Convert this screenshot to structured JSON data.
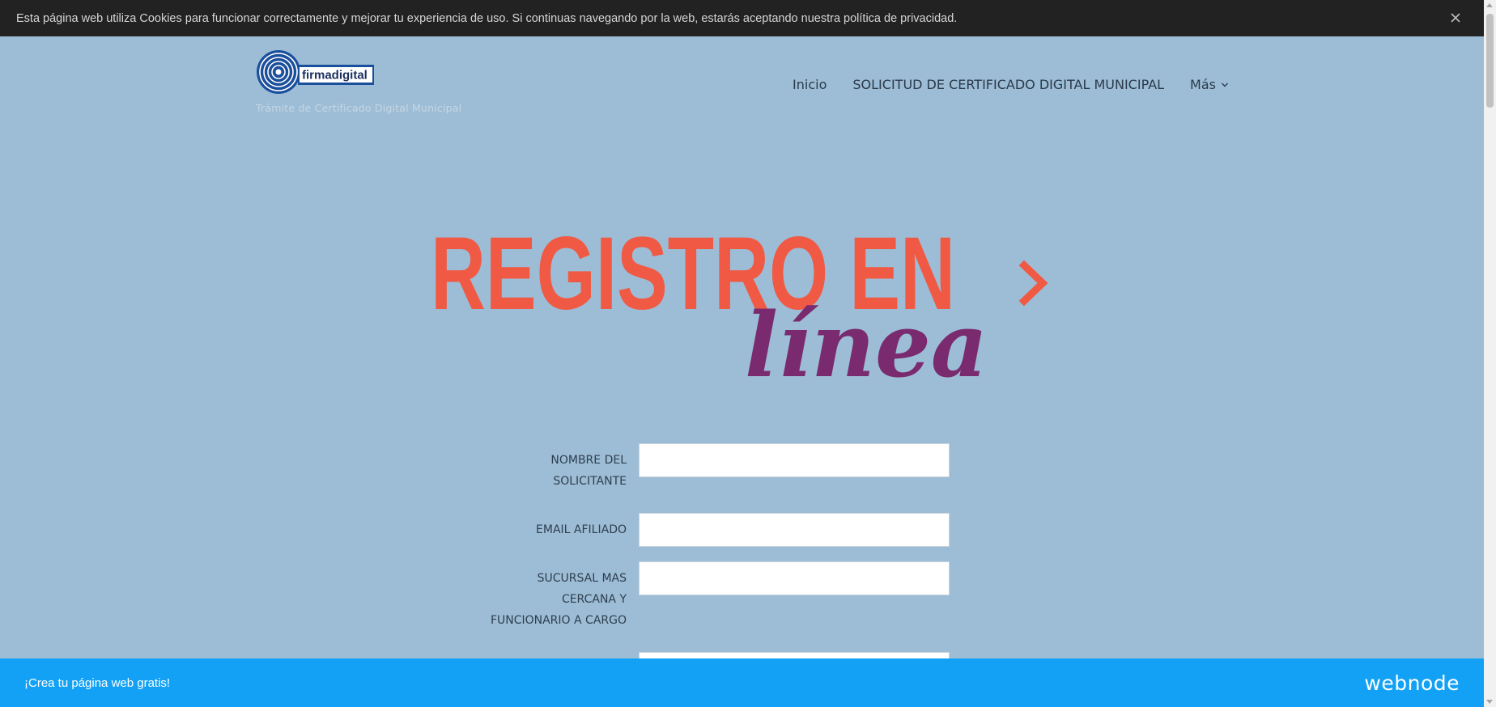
{
  "cookie_banner": {
    "text": "Esta página web utiliza Cookies para funcionar correctamente y mejorar tu experiencia de uso. Si continuas navegando por la web, estarás aceptando nuestra política de privacidad.",
    "close_icon": "close-icon"
  },
  "header": {
    "logo_text": "firmadigital",
    "tagline": "Trámite de Certificado Digital Municipal"
  },
  "nav": {
    "items": [
      {
        "label": "Inicio"
      },
      {
        "label": "SOLICITUD DE CERTIFICADO DIGITAL MUNICIPAL"
      },
      {
        "label": "Más"
      }
    ],
    "more_icon": "chevron-down-icon"
  },
  "hero": {
    "line1": "REGISTRO EN",
    "line2": "línea",
    "arrow_icon": "chevron-right-icon",
    "colors": {
      "primary": "#f05a44",
      "secondary": "#7a2a6e"
    }
  },
  "form": {
    "fields": [
      {
        "label_line1": "NOMBRE DEL",
        "label_line2": "SOLICITANTE",
        "value": ""
      },
      {
        "label_line1": "EMAIL AFILIADO",
        "value": ""
      },
      {
        "label_line1": "SUCURSAL MAS",
        "label_line2": "CERCANA Y",
        "label_line3": "FUNCIONARIO A CARGO",
        "value": ""
      }
    ]
  },
  "promo": {
    "text": "¡Crea tu página web gratis!",
    "brand": "webnode"
  },
  "colors": {
    "page_bg": "#9dbdd6",
    "cookie_bg": "#222222",
    "promo_bg": "#12a1f5"
  }
}
